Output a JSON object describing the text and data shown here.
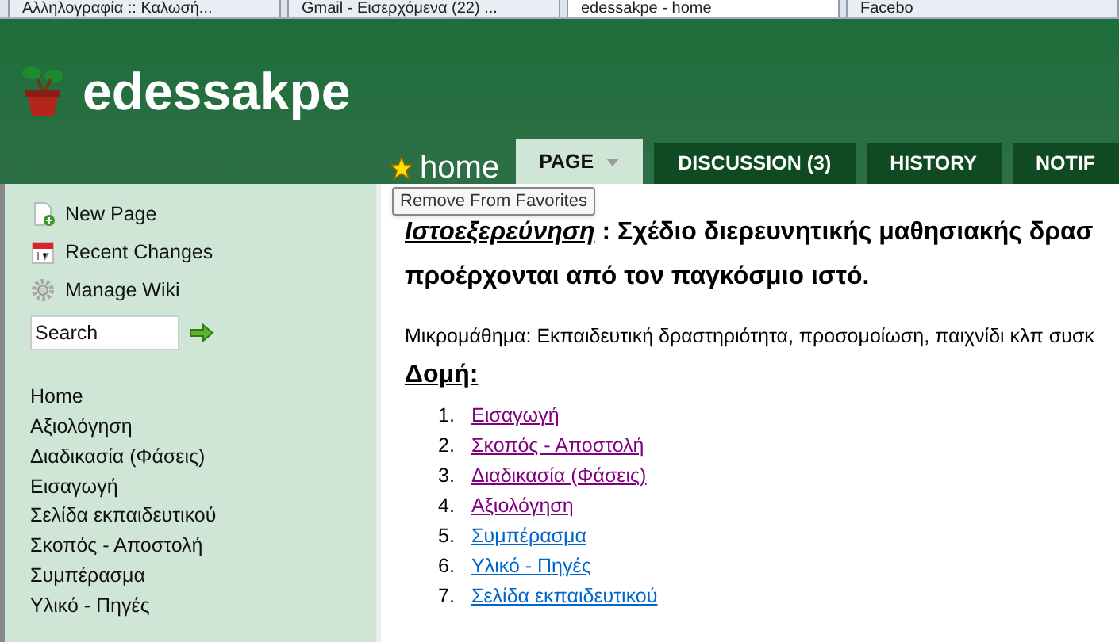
{
  "browser_tabs": [
    {
      "title": "Αλληλογραφία :: Καλωσή...",
      "selected": false
    },
    {
      "title": "Gmail - Εισερχόμενα (22) ...",
      "selected": false
    },
    {
      "title": "edessakpe - home",
      "selected": true
    },
    {
      "title": "Facebo",
      "selected": false
    }
  ],
  "site": {
    "title": "edessakpe"
  },
  "page_title": "home",
  "favorite": true,
  "tooltip": "Remove From Favorites",
  "tabs": [
    {
      "label": "PAGE",
      "selected": true,
      "dropdown": true
    },
    {
      "label": "DISCUSSION (3)",
      "selected": false,
      "dropdown": false
    },
    {
      "label": "HISTORY",
      "selected": false,
      "dropdown": false
    },
    {
      "label": "NOTIF",
      "selected": false,
      "dropdown": false
    }
  ],
  "sidebar": {
    "actions": [
      {
        "kind": "new",
        "label": "New Page"
      },
      {
        "kind": "recent",
        "label": "Recent Changes"
      },
      {
        "kind": "manage",
        "label": "Manage Wiki"
      }
    ],
    "search": {
      "value": "Search"
    },
    "nav": [
      "Home",
      "Αξιολόγηση",
      "Διαδικασία (Φάσεις)",
      "Εισαγωγή",
      "Σελίδα εκπαιδευτικού",
      "Σκοπός - Αποστολή",
      "Συμπέρασμα",
      "Υλικό - Πηγές"
    ]
  },
  "content": {
    "heading_link": "Ιστοεξερεύνηση",
    "heading_text": " : Σχέδιο διερευνητικής μαθησιακής δρασ",
    "heading_line2": "προέρχονται από τον παγκόσμιο ιστό.",
    "paragraph": "Μικρομάθημα: Εκπαιδευτική δραστηριότητα, προσομοίωση, παιχνίδι κλπ συσκ",
    "subheading": "Δομή:",
    "list": [
      {
        "number": "1.",
        "label": "Εισαγωγή",
        "visited": true
      },
      {
        "number": "2.",
        "label": "Σκοπός - Αποστολή",
        "visited": true
      },
      {
        "number": "3.",
        "label": "Διαδικασία (Φάσεις)",
        "visited": true
      },
      {
        "number": "4.",
        "label": "Αξιολόγηση",
        "visited": true
      },
      {
        "number": "5.",
        "label": "Συμπέρασμα",
        "visited": false
      },
      {
        "number": "6.",
        "label": "Υλικό - Πηγές",
        "visited": false
      },
      {
        "number": "7.",
        "label": "Σελίδα εκπαιδευτικού",
        "visited": false
      }
    ]
  }
}
